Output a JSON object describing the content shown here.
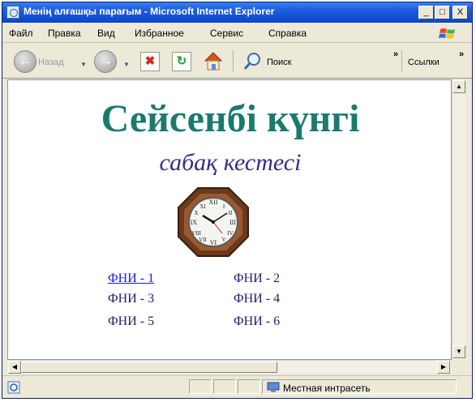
{
  "window": {
    "title": "Менің алғашқы парағым - Microsoft Internet Explorer",
    "controls": {
      "minimize": "_",
      "maximize": "□",
      "close": "X"
    }
  },
  "menu": [
    "Файл",
    "Правка",
    "Вид",
    "Избранное",
    "Сервис",
    "Справка"
  ],
  "toolbar": {
    "back_label": "Назад",
    "search_label": "Поиск",
    "links_label": "Ссылки",
    "chevron": "»"
  },
  "page": {
    "heading": "Сейсенбі күнгі",
    "subheading": "сабақ кестесі",
    "groups": [
      "ФНИ - 1",
      "ФНИ - 2",
      "ФНИ - 3",
      "ФНИ - 4",
      "ФНИ - 5",
      "ФНИ - 6"
    ]
  },
  "status": {
    "zone": "Местная интрасеть"
  },
  "colors": {
    "heading": "#1a7a6e",
    "subheading": "#3a2a8a",
    "link": "#1a1aee",
    "titlebar": "#0b46c7"
  },
  "icons": [
    "ie-page-icon",
    "windows-logo-icon",
    "back-icon",
    "forward-icon",
    "stop-icon",
    "refresh-icon",
    "home-icon",
    "search-icon",
    "zone-icon",
    "clock-image"
  ]
}
